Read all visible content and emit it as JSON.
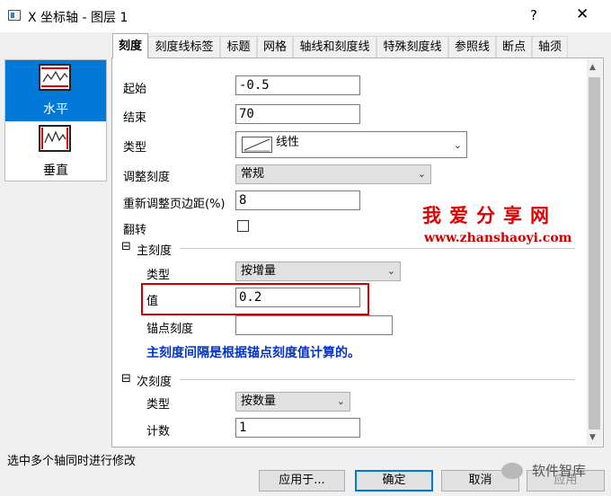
{
  "window": {
    "title": "X 坐标轴 - 图层 1",
    "help_label": "?",
    "close_label": "✕"
  },
  "left_panel": {
    "items": [
      {
        "label": "水平",
        "icon": "horizontal-axis-icon",
        "selected": true
      },
      {
        "label": "垂直",
        "icon": "vertical-axis-icon",
        "selected": false
      }
    ]
  },
  "tabs": [
    "刻度",
    "刻度线标签",
    "标题",
    "网格",
    "轴线和刻度线",
    "特殊刻度线",
    "参照线",
    "断点",
    "轴须"
  ],
  "active_tab": "刻度",
  "form": {
    "start_label": "起始",
    "start_value": "-0.5",
    "end_label": "结束",
    "end_value": "70",
    "type_label": "类型",
    "type_value": "线性",
    "type_icon": "linear-scale-icon",
    "rescale_label": "调整刻度",
    "rescale_value": "常规",
    "rescale_margin_label": "重新调整页边距(%)",
    "rescale_margin_value": "8",
    "flip_label": "翻转",
    "flip_checked": false
  },
  "major_ticks": {
    "group_label": "主刻度",
    "toggle": "⊟",
    "type_label": "类型",
    "type_value": "按增量",
    "value_label": "值",
    "value": "0.2",
    "anchor_label": "锚点刻度",
    "anchor_value": "",
    "note": "主刻度间隔是根据锚点刻度值计算的。"
  },
  "minor_ticks": {
    "group_label": "次刻度",
    "toggle": "⊟",
    "type_label": "类型",
    "type_value": "按数量",
    "count_label": "计数",
    "count_value": "1"
  },
  "watermark": {
    "chinese": "我爱分享网",
    "url": "www.zhanshaoyi.com",
    "wechat": "软件智库"
  },
  "status_text": "选中多个轴同时进行修改",
  "buttons": {
    "apply_to": "应用于...",
    "ok": "确定",
    "cancel": "取消",
    "apply": "应用"
  },
  "colors": {
    "selection": "#0078d7",
    "highlight_box": "#d00000",
    "note_text": "#0033cc"
  }
}
